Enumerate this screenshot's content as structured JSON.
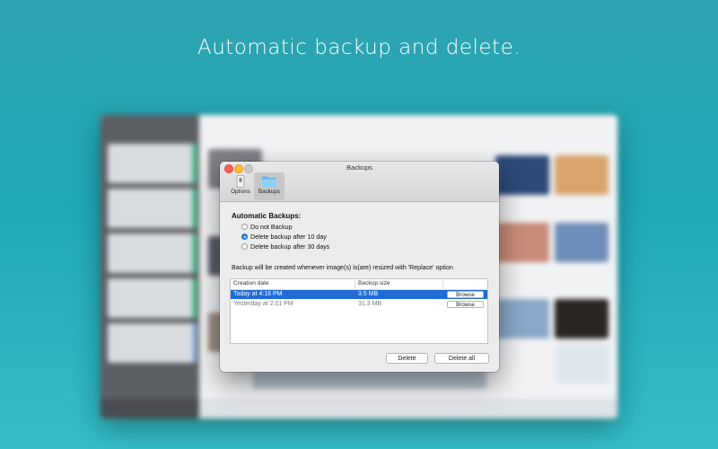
{
  "headline": "Automatic backup and delete.",
  "dialog": {
    "title": "Backups",
    "tabs": [
      {
        "label": "Options",
        "icon": "switch-icon"
      },
      {
        "label": "Backups",
        "icon": "folder-icon",
        "selected": true
      }
    ],
    "section_title": "Automatic Backups:",
    "radio_options": [
      {
        "label": "Do not Backup",
        "checked": false
      },
      {
        "label": "Delete backup after 10 day",
        "checked": true
      },
      {
        "label": "Delete backup after 30 days",
        "checked": false
      }
    ],
    "note": "Backup will be created whenever image(s) is(are) resized with 'Replace' option",
    "table": {
      "columns": [
        "Creation date",
        "Backup size"
      ],
      "rows": [
        {
          "date": "Today at 4:16 PM",
          "size": "3.5 MB",
          "action": "Browse",
          "selected": true
        },
        {
          "date": "Yesterday at 2:01 PM",
          "size": "31.3 MB",
          "action": "Browse",
          "selected": false
        }
      ]
    },
    "buttons": {
      "delete": "Delete",
      "delete_all": "Delete all"
    }
  },
  "colors": {
    "background": "#1fa9b6",
    "selection": "#1f6bd8",
    "radio_checked": "#1f86e8"
  }
}
